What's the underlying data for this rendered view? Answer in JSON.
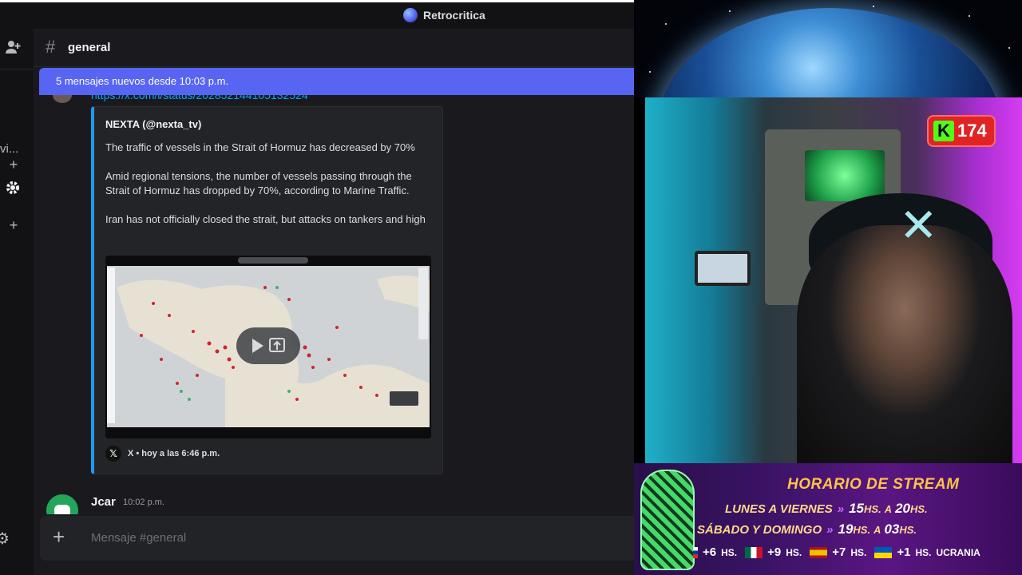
{
  "window": {
    "title": "Retrocritica"
  },
  "sidebar": {
    "partial_text": "vi..."
  },
  "channel": {
    "name": "general"
  },
  "new_messages_bar": {
    "text": "5 mensajes nuevos desde 10:03 p.m."
  },
  "messages": {
    "partial_link": "https://x.com/i/status/202852144105132524",
    "embed": {
      "author": "NEXTA (@nexta_tv)",
      "paragraphs": [
        "The traffic of vessels in the Strait of Hormuz has decreased by 70%",
        "Amid regional tensions, the number of vessels passing through the Strait of Hormuz has dropped by 70%, according to Marine Traffic.",
        "Iran has not officially closed the strait, but attacks on tankers and high"
      ],
      "footer": "X • hoy a las 6:46 p.m."
    },
    "next_message": {
      "author": "Jcar",
      "time": "10:02 p.m."
    }
  },
  "composer": {
    "placeholder": "Mensaje #general"
  },
  "stream": {
    "kick_viewers": "174",
    "schedule": {
      "title": "HORARIO DE STREAM",
      "rows": [
        {
          "days": "LUNES A VIERNES",
          "from": "15",
          "to": "20",
          "unit": "HS.",
          "sep": "A"
        },
        {
          "days": "SÁBADO Y DOMINGO",
          "from": "19",
          "to": "03",
          "unit": "HS.",
          "sep": "A"
        }
      ],
      "timezones": [
        {
          "offset": "+6",
          "unit": "HS."
        },
        {
          "offset": "+9",
          "unit": "HS."
        },
        {
          "offset": "+7",
          "unit": "HS."
        },
        {
          "offset": "+1",
          "unit": "HS.",
          "label": "UCRANIA"
        }
      ]
    }
  },
  "colors": {
    "blurple": "#5865f2",
    "link": "#00a8fc",
    "kick_green": "#53fc18",
    "schedule_gold": "#ffc24a"
  }
}
